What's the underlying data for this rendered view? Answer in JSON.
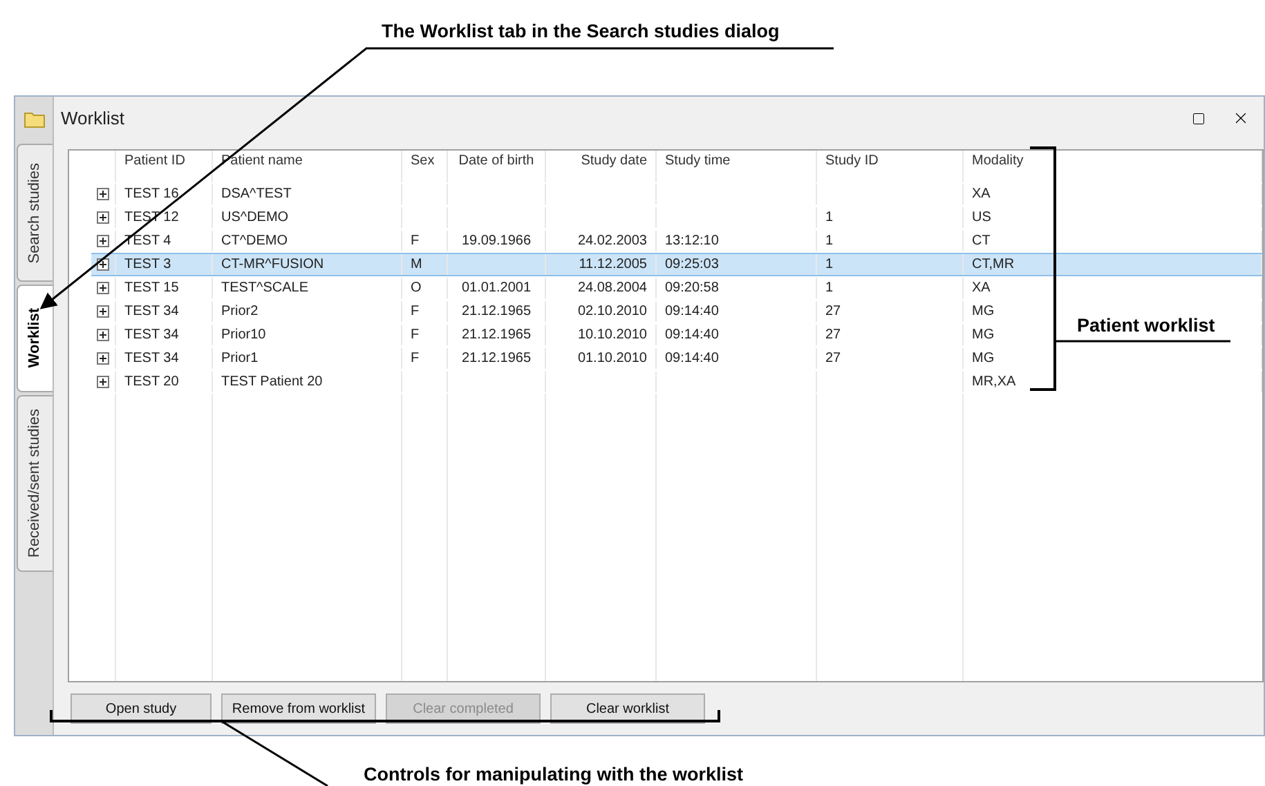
{
  "annotations": [
    {
      "kind": "top",
      "text": "The Worklist tab in the Search studies dialog"
    },
    {
      "kind": "right",
      "text": "Patient worklist"
    },
    {
      "kind": "bottom",
      "text": "Controls for manipulating with the worklist"
    }
  ],
  "window": {
    "title": "Worklist"
  },
  "tabs": [
    {
      "label": "Search studies",
      "selected": false
    },
    {
      "label": "Worklist",
      "selected": true
    },
    {
      "label": "Received/sent studies",
      "selected": false
    }
  ],
  "table": {
    "columns": [
      "Patient ID",
      "Patient name",
      "Sex",
      "Date of birth",
      "Study date",
      "Study time",
      "Study ID",
      "Modality"
    ],
    "rows": [
      {
        "selected": false,
        "cells": [
          "TEST 16",
          "DSA^TEST",
          "",
          "",
          "",
          "",
          "",
          "XA"
        ]
      },
      {
        "selected": false,
        "cells": [
          "TEST 12",
          "US^DEMO",
          "",
          "",
          "",
          "",
          "1",
          "US"
        ]
      },
      {
        "selected": false,
        "cells": [
          "TEST 4",
          "CT^DEMO",
          "F",
          "19.09.1966",
          "24.02.2003",
          "13:12:10",
          "1",
          "CT"
        ]
      },
      {
        "selected": true,
        "cells": [
          "TEST 3",
          "CT-MR^FUSION",
          "M",
          "",
          "11.12.2005",
          "09:25:03",
          "1",
          "CT,MR"
        ]
      },
      {
        "selected": false,
        "cells": [
          "TEST 15",
          "TEST^SCALE",
          "O",
          "01.01.2001",
          "24.08.2004",
          "09:20:58",
          "1",
          "XA"
        ]
      },
      {
        "selected": false,
        "cells": [
          "TEST 34",
          "Prior2",
          "F",
          "21.12.1965",
          "02.10.2010",
          "09:14:40",
          "27",
          "MG"
        ]
      },
      {
        "selected": false,
        "cells": [
          "TEST 34",
          "Prior10",
          "F",
          "21.12.1965",
          "10.10.2010",
          "09:14:40",
          "27",
          "MG"
        ]
      },
      {
        "selected": false,
        "cells": [
          "TEST 34",
          "Prior1",
          "F",
          "21.12.1965",
          "01.10.2010",
          "09:14:40",
          "27",
          "MG"
        ]
      },
      {
        "selected": false,
        "cells": [
          "TEST 20",
          "TEST Patient 20",
          "",
          "",
          "",
          "",
          "",
          "MR,XA"
        ]
      }
    ]
  },
  "buttons": [
    {
      "label": "Open study",
      "disabled": false
    },
    {
      "label": "Remove from worklist",
      "disabled": false
    },
    {
      "label": "Clear completed",
      "disabled": true
    },
    {
      "label": "Clear worklist",
      "disabled": false
    }
  ]
}
